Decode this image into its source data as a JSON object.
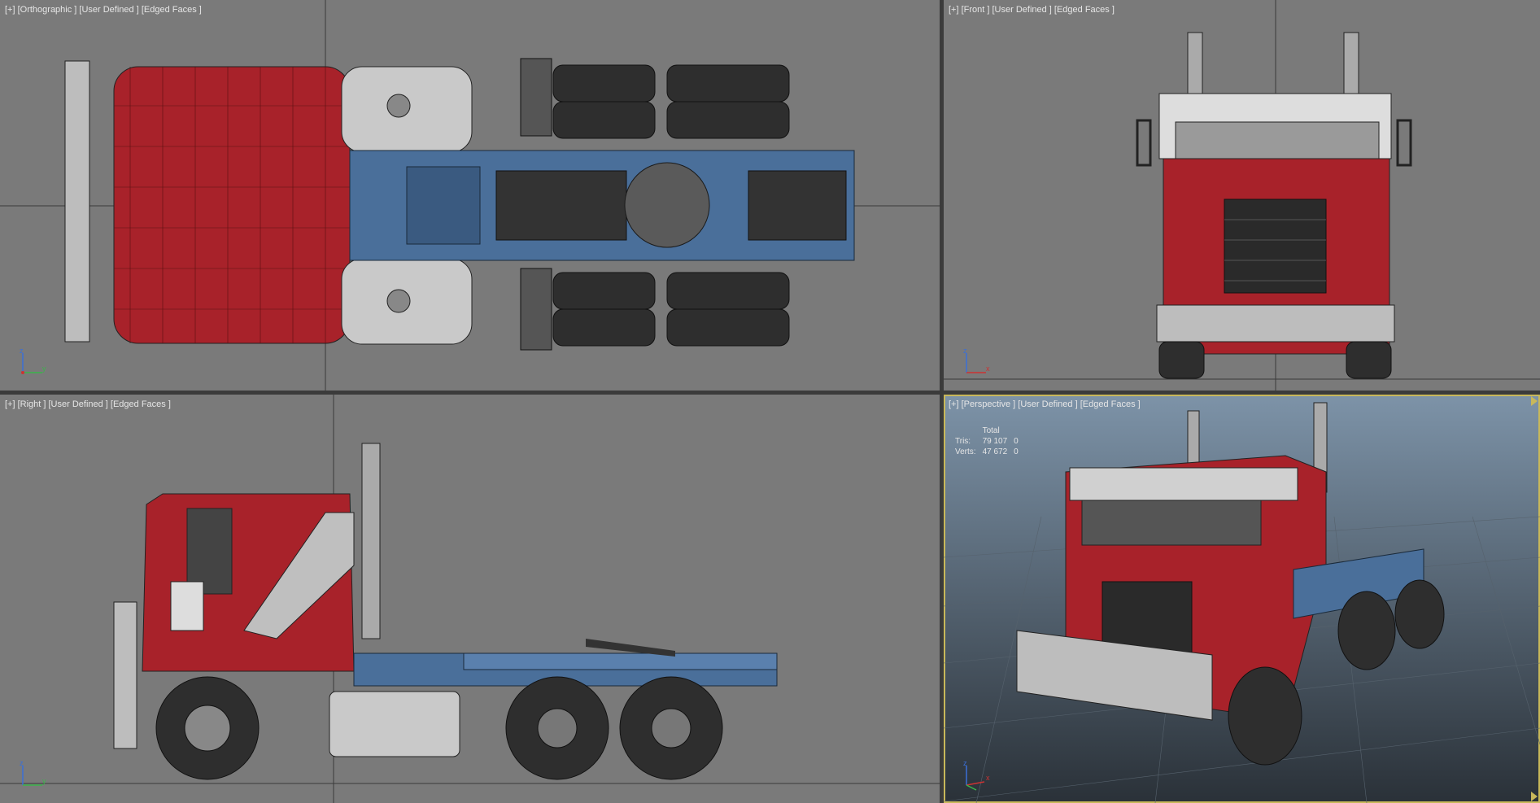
{
  "viewports": {
    "top": {
      "label": "[+] [Orthographic ] [User Defined ] [Edged Faces ]"
    },
    "front": {
      "label": "[+] [Front ] [User Defined ] [Edged Faces ]"
    },
    "right": {
      "label": "[+] [Right ] [User Defined ] [Edged Faces ]"
    },
    "perspective": {
      "label": "[+] [Perspective ] [User Defined ] [Edged Faces ]"
    }
  },
  "stats": {
    "header": "Total",
    "rows": [
      {
        "label": "Tris:",
        "total": "79 107",
        "selected": "0"
      },
      {
        "label": "Verts:",
        "total": "47 672",
        "selected": "0"
      }
    ]
  },
  "axes": {
    "top": {
      "a": "z",
      "b": "y"
    },
    "front": {
      "a": "z",
      "b": "x"
    },
    "right": {
      "a": "z",
      "b": "y"
    },
    "perspective": {
      "a": "z",
      "b": "x"
    }
  },
  "colors": {
    "viewport_bg": "#7a7a7a",
    "cab_red": "#a8222a",
    "frame_blue": "#4a6f9a",
    "chrome": "#c9c9c9",
    "tire": "#2e2e2e",
    "persp_sky_top": "#7d93a8",
    "persp_sky_bottom": "#2a3138"
  }
}
